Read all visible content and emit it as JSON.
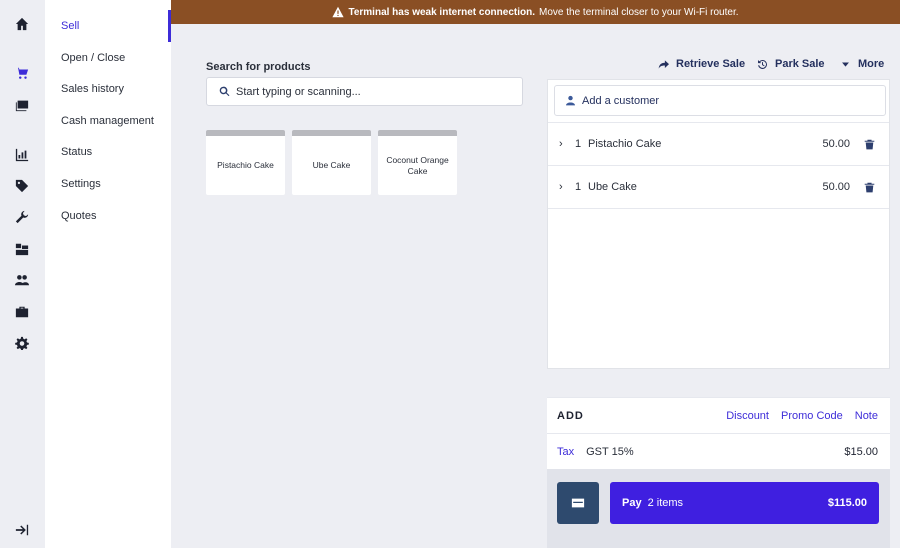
{
  "banner": {
    "bold": "Terminal has weak internet connection.",
    "text": "Move the terminal closer to your Wi-Fi router."
  },
  "rail": [
    "home-icon",
    "cart-icon",
    "register-icon",
    "reports-icon",
    "tag-icon",
    "wrench-icon",
    "inventory-icon",
    "users-icon",
    "briefcase-icon",
    "gear-icon",
    "collapse-icon"
  ],
  "subnav": {
    "items": [
      "Sell",
      "Open / Close",
      "Sales history",
      "Cash management",
      "Status",
      "Settings",
      "Quotes"
    ],
    "active": "Sell"
  },
  "search": {
    "label": "Search for products",
    "placeholder": "Start typing or scanning..."
  },
  "products": [
    "Pistachio Cake",
    "Ube Cake",
    "Coconut Orange Cake"
  ],
  "actions": {
    "retrieve": "Retrieve Sale",
    "park": "Park Sale",
    "more": "More"
  },
  "cart": {
    "customer_placeholder": "Add a customer",
    "lines": [
      {
        "qty": "1",
        "name": "Pistachio Cake",
        "price": "50.00"
      },
      {
        "qty": "1",
        "name": "Ube Cake",
        "price": "50.00"
      }
    ]
  },
  "totals": {
    "add_title": "ADD",
    "discount": "Discount",
    "promo": "Promo Code",
    "note": "Note",
    "tax_label": "Tax",
    "tax_name": "GST 15%",
    "tax_value": "$15.00"
  },
  "pay": {
    "label": "Pay",
    "count": "2 items",
    "total": "$115.00"
  },
  "colors": {
    "accent": "#3d2cd8",
    "banner": "#8a4f24",
    "pay": "#3f1fe0",
    "cash_button": "#2e4a6e"
  }
}
